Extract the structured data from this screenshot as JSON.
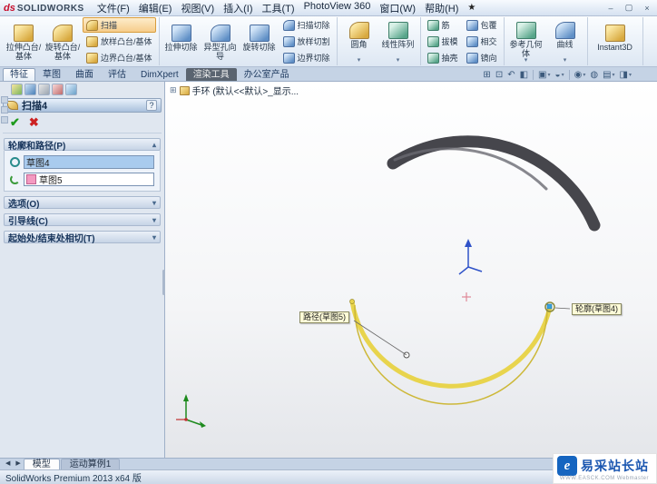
{
  "titlebar": {
    "logo_ds": "ds",
    "logo_text": "SOLIDWORKS",
    "menus": [
      "文件(F)",
      "编辑(E)",
      "视图(V)",
      "插入(I)",
      "工具(T)",
      "PhotoView 360",
      "窗口(W)",
      "帮助(H)"
    ]
  },
  "ribbon": {
    "extrude_boss": "拉伸凸台/基体",
    "revolve_boss": "旋转凸台/基体",
    "sweep": "扫描",
    "loft_boss": "放样凸台/基体",
    "boundary_boss": "边界凸台/基体",
    "extrude_cut": "拉伸切除",
    "hole_wizard": "异型孔向导",
    "revolve_cut": "旋转切除",
    "sweep_cut": "扫描切除",
    "loft_cut": "放样切割",
    "boundary_cut": "边界切除",
    "fillet": "圆角",
    "linear_pattern": "线性阵列",
    "rib": "筋",
    "draft": "拔模",
    "shell": "抽壳",
    "wrap": "包覆",
    "intersect": "相交",
    "mirror": "镜向",
    "ref_geometry": "参考几何体",
    "curves": "曲线",
    "instant3d": "Instant3D"
  },
  "command_tabs": [
    "特征",
    "草图",
    "曲面",
    "评估",
    "DimXpert",
    "渲染工具",
    "办公室产品"
  ],
  "hud_icons": [
    {
      "name": "zoom-fit",
      "glyph": "⊞"
    },
    {
      "name": "zoom-area",
      "glyph": "⊡"
    },
    {
      "name": "previous-view",
      "glyph": "↶"
    },
    {
      "name": "section-view",
      "glyph": "◧"
    },
    {
      "name": "view-orientation",
      "glyph": "▣",
      "arrow": "▾"
    },
    {
      "name": "display-style",
      "glyph": "◒",
      "arrow": "▾"
    },
    {
      "name": "hide-show-items",
      "glyph": "◉",
      "arrow": "▾"
    },
    {
      "name": "edit-appearance",
      "glyph": "◍"
    },
    {
      "name": "apply-scene",
      "glyph": "▤",
      "arrow": "▾"
    },
    {
      "name": "view-settings",
      "glyph": "◨",
      "arrow": "▾"
    }
  ],
  "property_manager": {
    "title": "扫描4",
    "help": "?",
    "sections": {
      "profile_path": "轮廓和路径(P)",
      "options": "选项(O)",
      "guide_curves": "引导线(C)",
      "start_end_tangency": "起始处/结束处相切(T)"
    },
    "profile_value": "草图4",
    "path_value": "草图5"
  },
  "viewport": {
    "document": "手环 (默认<<默认>_显示...",
    "callout_path": "路径(草图5)",
    "callout_profile": "轮廓(草图4)"
  },
  "bottom_tabs": {
    "model": "模型",
    "motion_study": "运动算例1"
  },
  "statusbar": {
    "text": "SolidWorks Premium 2013 x64 版"
  },
  "watermark": {
    "title": "易采站长站",
    "subtitle": "WWW.EASCK.COM Webmaster"
  },
  "icons": {
    "ok": "✔",
    "cancel": "✖",
    "collapse": "▴",
    "expand": "▾",
    "prev": "◀",
    "next": "▶",
    "star": "★",
    "minimize": "–",
    "restore": "▢",
    "close": "×",
    "flyout": "⊞"
  },
  "colors": {
    "selection_blue": "#a9cbee",
    "path_pink": "#f49ac1",
    "sweep_yellow": "#e8d44d",
    "solid_gray": "#46464c",
    "brand_red": "#c8102e",
    "watermark_blue": "#1565c0"
  }
}
